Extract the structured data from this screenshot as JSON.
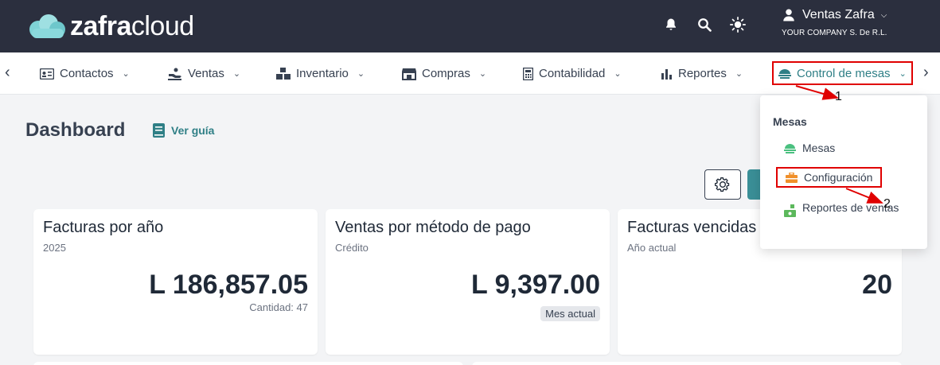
{
  "brand": {
    "logo_prefix": "zafra",
    "logo_suffix": "cloud"
  },
  "header": {
    "icons": [
      "bell-icon",
      "search-icon",
      "sun-icon"
    ],
    "user_name": "Ventas Zafra",
    "company": "YOUR COMPANY S. De R.L."
  },
  "nav": {
    "items": [
      {
        "label": "Contactos",
        "icon": "contact-card-icon"
      },
      {
        "label": "Ventas",
        "icon": "sales-hand-icon"
      },
      {
        "label": "Inventario",
        "icon": "boxes-icon"
      },
      {
        "label": "Compras",
        "icon": "store-icon"
      },
      {
        "label": "Contabilidad",
        "icon": "calculator-icon"
      },
      {
        "label": "Reportes",
        "icon": "bar-chart-icon"
      },
      {
        "label": "Control de mesas",
        "icon": "table-dish-icon"
      }
    ]
  },
  "page": {
    "title": "Dashboard",
    "guide_label": "Ver guía"
  },
  "cards": [
    {
      "title": "Facturas por año",
      "subtitle": "2025",
      "value": "L 186,857.05",
      "note": "Cantidad: 47"
    },
    {
      "title": "Ventas por método de pago",
      "subtitle": "Crédito",
      "value": "L 9,397.00",
      "badge": "Mes actual"
    },
    {
      "title": "Facturas vencidas",
      "subtitle": "Año actual",
      "value": "20"
    }
  ],
  "dropdown": {
    "header": "Mesas",
    "items": [
      {
        "label": "Mesas",
        "icon": "table-green-icon"
      },
      {
        "label": "Configuración",
        "icon": "toolbox-icon"
      },
      {
        "label": "Reportes de ventas",
        "icon": "money-report-icon"
      }
    ]
  },
  "annotations": {
    "step1": "1",
    "step2": "2"
  },
  "colors": {
    "topbar": "#2b2f3e",
    "accent": "#2f7f86",
    "highlight": "#e00000"
  }
}
